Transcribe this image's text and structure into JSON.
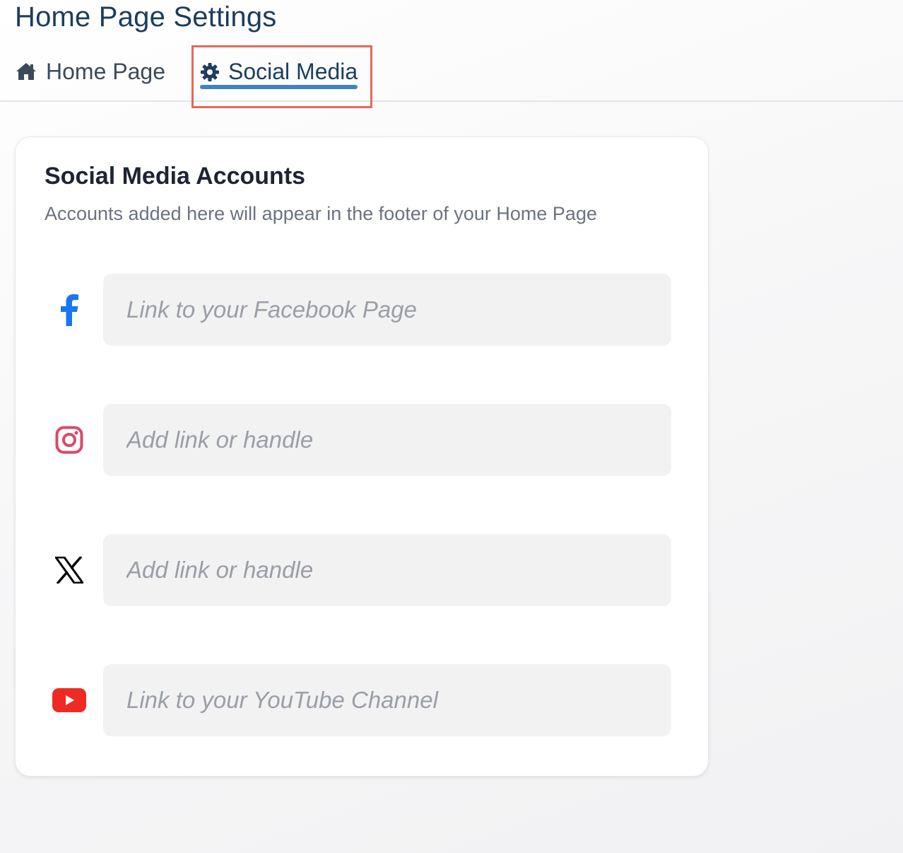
{
  "header": {
    "title": "Home Page Settings"
  },
  "tabs": [
    {
      "label": "Home Page",
      "icon": "home-icon",
      "active": false
    },
    {
      "label": "Social Media",
      "icon": "gear-icon",
      "active": true
    }
  ],
  "card": {
    "title": "Social Media Accounts",
    "subtitle": "Accounts added here will appear in the footer of your Home Page",
    "fields": [
      {
        "network": "facebook",
        "icon": "facebook-icon",
        "value": "",
        "placeholder": "Link to your Facebook Page",
        "color": "#1877f2"
      },
      {
        "network": "instagram",
        "icon": "instagram-icon",
        "value": "",
        "placeholder": "Add link or handle",
        "color": "#d94a6a"
      },
      {
        "network": "x",
        "icon": "x-icon",
        "value": "",
        "placeholder": "Add link or handle",
        "color": "#000000"
      },
      {
        "network": "youtube",
        "icon": "youtube-icon",
        "value": "",
        "placeholder": "Link to your YouTube Channel",
        "color": "#ee2a24"
      }
    ]
  },
  "colors": {
    "title": "#1c3d5e",
    "accent": "#3f83bf",
    "highlight": "#e46a5a",
    "input_bg": "#f2f2f3"
  }
}
